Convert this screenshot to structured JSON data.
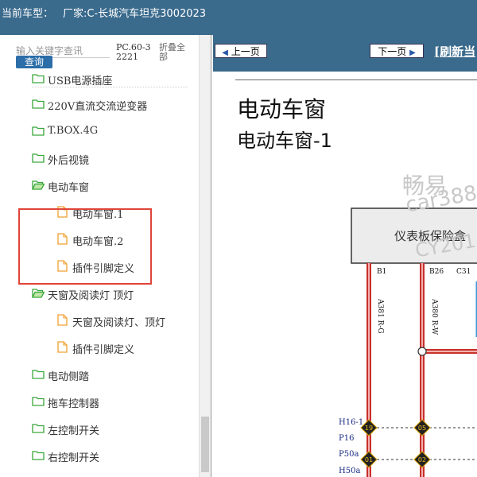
{
  "window": {
    "label": "当前车型：",
    "maker": "厂家:C-长城汽车坦克3002023"
  },
  "search": {
    "placeholder": "输入关键字查讯",
    "button": "查询",
    "model_code": "PC.60-32221",
    "collapse_all": "折叠全部"
  },
  "tree": {
    "items": [
      {
        "label": "USB电源插座",
        "type": "folder"
      },
      {
        "label": "220V直流交流逆变器",
        "type": "folder"
      },
      {
        "label": "T.BOX.4G",
        "type": "folder"
      },
      {
        "label": "外后视镜",
        "type": "folder"
      },
      {
        "label": "电动车窗",
        "type": "folder-open"
      },
      {
        "label": "电动车窗.1",
        "type": "doc"
      },
      {
        "label": "电动车窗.2",
        "type": "doc"
      },
      {
        "label": "插件引脚定义",
        "type": "doc"
      },
      {
        "label": "天窗及阅读灯 顶灯",
        "type": "folder-open"
      },
      {
        "label": "天窗及阅读灯、顶灯",
        "type": "doc"
      },
      {
        "label": "插件引脚定义",
        "type": "doc"
      },
      {
        "label": "电动侧踏",
        "type": "folder"
      },
      {
        "label": "拖车控制器",
        "type": "folder"
      },
      {
        "label": "左控制开关",
        "type": "folder"
      },
      {
        "label": "右控制开关",
        "type": "folder"
      }
    ]
  },
  "nav": {
    "prev": "上一页",
    "next": "下一页",
    "refresh": "[刷新当"
  },
  "doc": {
    "title": "电动车窗",
    "subtitle": "电动车窗-1",
    "watermark_1": "畅易",
    "watermark_2": "car388.co",
    "watermark_3": "CY201",
    "fuse_box": "仪表板保险盒",
    "pins": {
      "b1": "B1",
      "b26": "B26",
      "c31": "C31"
    },
    "wires": {
      "left": "A381 R-G",
      "right": "A380 R-W"
    },
    "connectors": [
      "H16-1",
      "P16",
      "P50a",
      "H50a"
    ],
    "terminals": [
      "19",
      "05",
      "01",
      "02"
    ]
  },
  "colors": {
    "header": "#3a6a8c",
    "search_button": "#2b6ea8",
    "highlight": "#e0453a",
    "folder": "#3aa63a",
    "doc_icon": "#f0a030",
    "wire_red": "#c8302a"
  }
}
